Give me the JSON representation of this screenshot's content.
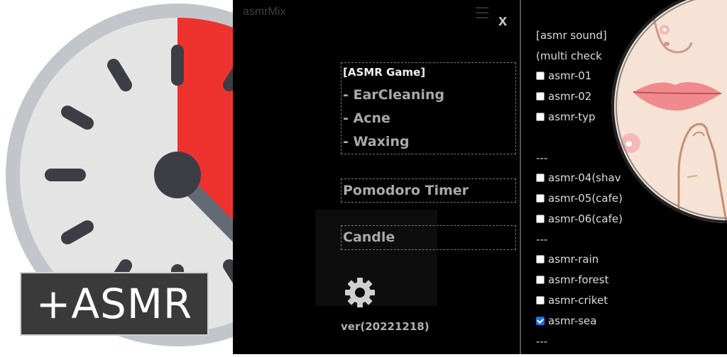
{
  "badge_text": "+ASMR",
  "app": {
    "title": "asmrMix",
    "close_label": "x",
    "game_header": "[ASMR Game]",
    "game_items": [
      "- EarCleaning",
      "- Acne",
      "- Waxing"
    ],
    "pomodoro_label": "Pomodoro Timer",
    "candle_label": "Candle",
    "version": "ver(20221218)"
  },
  "sound_panel": {
    "header": "[asmr sound]",
    "subheader": "(multi check",
    "items": [
      {
        "label": "asmr-01",
        "checked": false
      },
      {
        "label": "asmr-02",
        "checked": false
      },
      {
        "label": "asmr-typ",
        "checked": false
      },
      {
        "label": "asmr-04(shav",
        "checked": false
      },
      {
        "label": "asmr-05(cafe)",
        "checked": false
      },
      {
        "label": "asmr-06(cafe)",
        "checked": false
      },
      {
        "label": "asmr-rain",
        "checked": false
      },
      {
        "label": "asmr-forest",
        "checked": false
      },
      {
        "label": "asmr-criket",
        "checked": false
      },
      {
        "label": "asmr-sea",
        "checked": true
      }
    ],
    "separator": "---"
  },
  "colors": {
    "timer_red": "#ee332f",
    "timer_face": "#e4e4e4",
    "timer_rim": "#c2c6cb",
    "timer_marks": "#3d3d45",
    "app_bg": "#000000",
    "text_gray": "#a9a9a9",
    "checkbox_checked": "#1a73e8"
  },
  "icons": [
    "timer-clock-icon",
    "menu-icon",
    "close-icon",
    "gear-icon",
    "checkbox-icon",
    "face-illustration"
  ]
}
